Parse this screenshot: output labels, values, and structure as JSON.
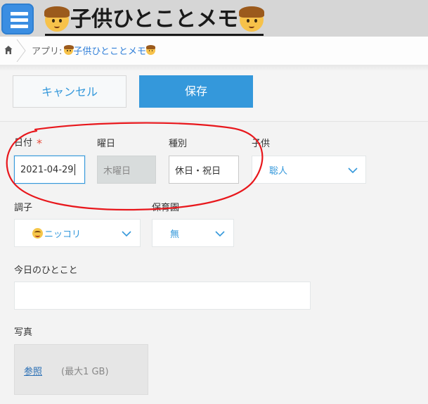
{
  "header": {
    "app_title": "子供ひとことメモ",
    "title_icon": "boy-face-emoji"
  },
  "breadcrumb": {
    "prefix": "アプリ:",
    "app_link": "子供ひとことメモ"
  },
  "toolbar": {
    "cancel_label": "キャンセル",
    "save_label": "保存"
  },
  "fields": {
    "date": {
      "label": "日付",
      "required_mark": "*",
      "value": "2021-04-29"
    },
    "weekday": {
      "label": "曜日",
      "value": "木曜日"
    },
    "day_type": {
      "label": "種別",
      "value": "休日・祝日"
    },
    "child": {
      "label": "子供",
      "selected": "聡人"
    },
    "mood": {
      "label": "調子",
      "selected": "ニッコリ",
      "icon": "smiling-face-emoji"
    },
    "nursery": {
      "label": "保育園",
      "selected": "無"
    },
    "comment": {
      "label": "今日のひとこと",
      "value": ""
    },
    "photo": {
      "label": "写真",
      "browse_label": "参照",
      "limit_text": "(最大1 GB)"
    }
  },
  "colors": {
    "accent": "#3498db",
    "required": "#e74c3c",
    "annotation": "#e8171c",
    "app_icon": "#3b8ee2"
  }
}
